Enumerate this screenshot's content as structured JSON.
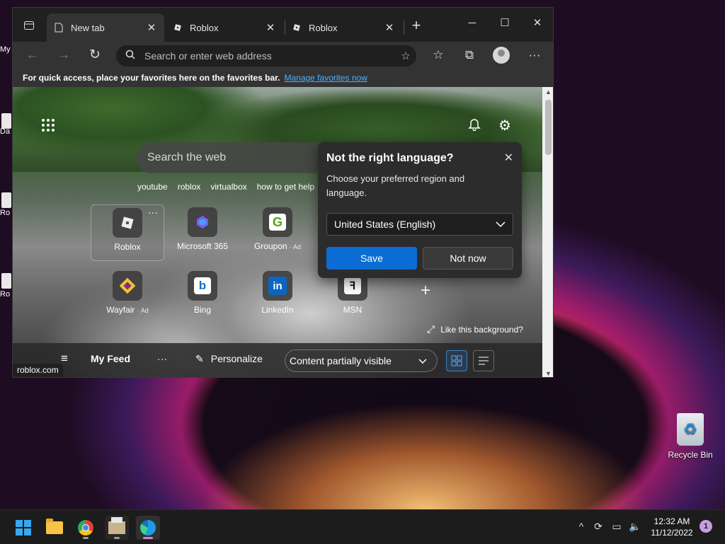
{
  "desktop": {
    "edge_labels": [
      "My",
      "Da",
      "Ro",
      "Ro"
    ],
    "recycle_bin_label": "Recycle Bin"
  },
  "browser": {
    "tabs": [
      {
        "label": "New tab",
        "icon": "page-icon",
        "active": true
      },
      {
        "label": "Roblox",
        "icon": "roblox-icon",
        "active": false
      },
      {
        "label": "Roblox",
        "icon": "roblox-icon",
        "active": false
      }
    ],
    "address_placeholder": "Search or enter web address",
    "favorites_bar": {
      "message": "For quick access, place your favorites here on the favorites bar.",
      "link": "Manage favorites now"
    }
  },
  "newtab": {
    "search_placeholder": "Search the web",
    "chips": [
      "youtube",
      "roblox",
      "virtualbox",
      "how to get help"
    ],
    "tiles": [
      {
        "label": "Roblox",
        "ad": ""
      },
      {
        "label": "Microsoft 365",
        "ad": ""
      },
      {
        "label": "Groupon",
        "ad": "· Ad"
      },
      {
        "label": "Wayfair",
        "ad": "· Ad"
      },
      {
        "label": "Bing",
        "ad": ""
      },
      {
        "label": "LinkedIn",
        "ad": ""
      },
      {
        "label": "MSN",
        "ad": ""
      }
    ],
    "like_background": "Like this background?",
    "feed": {
      "title": "My Feed",
      "personalize": "Personalize",
      "visibility": "Content partially visible"
    },
    "status_url": "roblox.com"
  },
  "language_dialog": {
    "title": "Not the right language?",
    "description": "Choose your preferred region and language.",
    "selected_language": "United States (English)",
    "save": "Save",
    "not_now": "Not now"
  },
  "taskbar": {
    "time": "12:32 AM",
    "date": "11/12/2022",
    "notification_count": "1"
  },
  "colors": {
    "accent": "#0b6dd4",
    "link": "#4fb0ff"
  }
}
